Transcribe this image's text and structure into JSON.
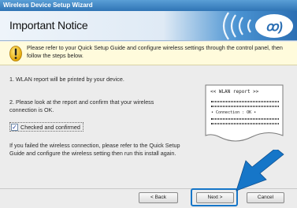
{
  "window": {
    "title": "Wireless Device Setup Wizard"
  },
  "header": {
    "title": "Important Notice"
  },
  "notice": {
    "icon": "warning-icon",
    "text": "Please refer to your Quick Setup Guide and configure wireless settings through the control panel, then follow the steps below."
  },
  "steps": {
    "step1": "1. WLAN report will be printed by your device.",
    "step2": "2. Please look at the report and confirm that your wireless connection is OK.",
    "failure": "If you failed the wireless connection, please refer to the Quick Setup Guide and configure the wireless setting then run this install again."
  },
  "checkbox": {
    "label": "Checked and confirmed",
    "checked": true,
    "mark": "✓"
  },
  "report": {
    "title": "<< WLAN report >>",
    "connection": "•    Connection : OK    •"
  },
  "buttons": {
    "back": "< Back",
    "next": "Next >",
    "cancel": "Cancel"
  },
  "colors": {
    "accent": "#1676c8",
    "title_bar": "#2f74b5",
    "notice_bg": "#fffbdc"
  }
}
